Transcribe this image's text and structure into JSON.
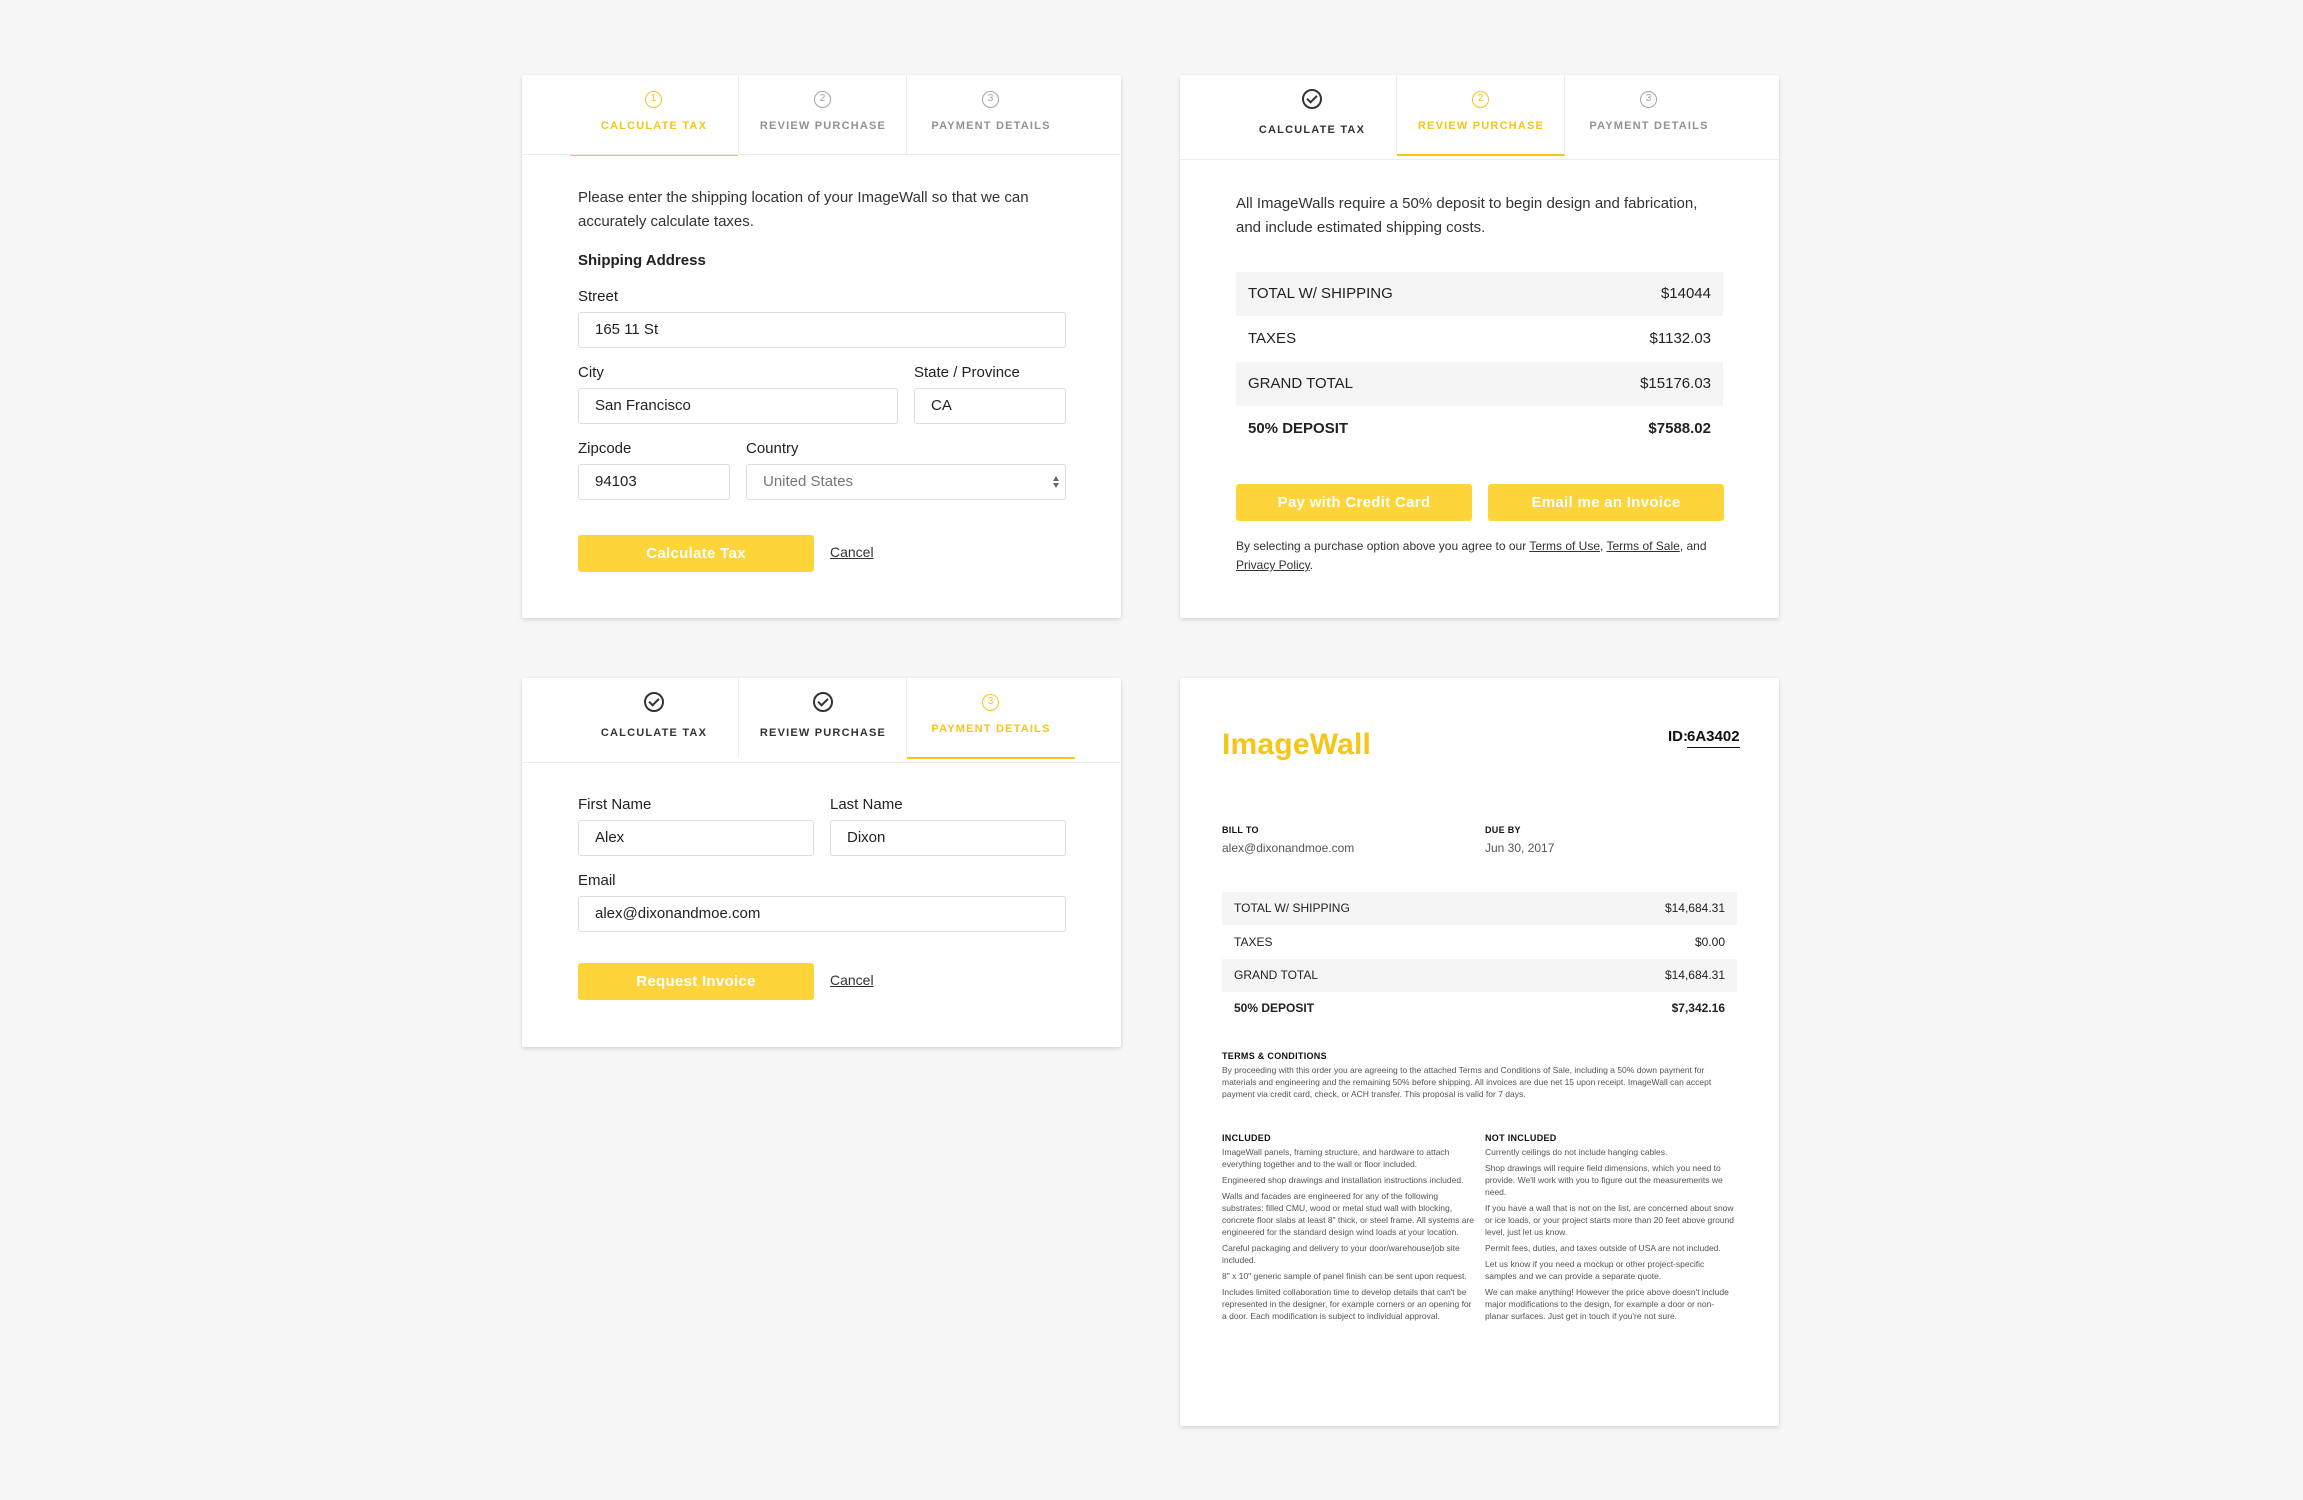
{
  "steps": {
    "calculate_tax": "CALCULATE TAX",
    "review_purchase": "REVIEW PURCHASE",
    "payment_details": "PAYMENT DETAILS",
    "num1": "1",
    "num2": "2",
    "num3": "3"
  },
  "tax_form": {
    "intro": "Please enter the shipping location of your ImageWall so that we can accurately calculate taxes.",
    "section_title": "Shipping Address",
    "street_label": "Street",
    "street_value": "165 11 St",
    "city_label": "City",
    "city_value": "San Francisco",
    "state_label": "State / Province",
    "state_value": "CA",
    "zip_label": "Zipcode",
    "zip_value": "94103",
    "country_label": "Country",
    "country_value": "United States",
    "submit_label": "Calculate Tax",
    "cancel_label": "Cancel"
  },
  "review": {
    "intro": "All ImageWalls require a 50% deposit to begin design and fabrication, and include estimated shipping costs.",
    "rows": [
      {
        "label": "TOTAL W/ SHIPPING",
        "value": "$14044"
      },
      {
        "label": "TAXES",
        "value": "$1132.03"
      },
      {
        "label": "GRAND TOTAL",
        "value": "$15176.03"
      },
      {
        "label": "50% DEPOSIT",
        "value": "$7588.02"
      }
    ],
    "pay_card_label": "Pay with Credit Card",
    "email_invoice_label": "Email me an Invoice",
    "legal_prefix": "By selecting a purchase option above you agree to our ",
    "terms_of_use": "Terms of Use",
    "comma": ", ",
    "terms_of_sale": "Terms of Sale",
    "and": ", and",
    "privacy_policy": "Privacy Policy",
    "period": "."
  },
  "payment_form": {
    "first_name_label": "First Name",
    "first_name_value": "Alex",
    "last_name_label": "Last Name",
    "last_name_value": "Dixon",
    "email_label": "Email",
    "email_value": "alex@dixonandmoe.com",
    "submit_label": "Request Invoice",
    "cancel_label": "Cancel"
  },
  "invoice": {
    "logo": "ImageWall",
    "id_label": "ID:",
    "id_value": "6A3402",
    "bill_to_label": "BILL TO",
    "bill_to_value": "alex@dixonandmoe.com",
    "due_by_label": "DUE BY",
    "due_by_value": "Jun 30, 2017",
    "rows": [
      {
        "label": "TOTAL W/ SHIPPING",
        "value": "$14,684.31"
      },
      {
        "label": "TAXES",
        "value": "$0.00"
      },
      {
        "label": "GRAND TOTAL",
        "value": "$14,684.31"
      },
      {
        "label": "50% DEPOSIT",
        "value": "$7,342.16"
      }
    ],
    "terms_title": "TERMS & CONDITIONS",
    "terms_text": "By proceeding with this order you are agreeing to the attached Terms and Conditions of Sale, including a 50% down payment for materials and engineering and the remaining 50% before shipping. All invoices are due net 15 upon receipt. ImageWall can accept payment via credit card, check, or ACH transfer. This proposal is valid for 7 days.",
    "included_title": "INCLUDED",
    "included": [
      "ImageWall panels, framing structure, and hardware to attach everything together and to the wall or floor included.",
      "Engineered shop drawings and installation instructions included.",
      "Walls and facades are engineered for any of the following substrates: filled CMU, wood or metal stud wall with blocking, concrete floor slabs at least 8\" thick, or steel frame. All systems are engineered for the standard design wind loads at your location.",
      "Careful packaging and delivery to your door/warehouse/job site included.",
      "8\" x 10\" generic sample of panel finish can be sent upon request.",
      "Includes limited collaboration time to develop details that can't be represented in the designer, for example corners or an opening for a door. Each modification is subject to individual approval."
    ],
    "not_included_title": "NOT INCLUDED",
    "not_included": [
      "Currently ceilings do not include hanging cables.",
      "Shop drawings will require field dimensions, which you need to provide. We'll work with you to figure out the measurements we need.",
      "If you have a wall that is not on the list, are concerned about snow or ice loads, or your project starts more than 20 feet above ground level, just let us know.",
      "Permit fees, duties, and taxes outside of USA are not included.",
      "Let us know if you need a mockup or other project-specific samples and we can provide a separate quote.",
      "We can make anything! However the price above doesn't include major modifications to the design, for example a door or non-planar surfaces. Just get in touch if you're not sure."
    ]
  },
  "colors": {
    "accent": "#f5c518",
    "button": "#fdd43a",
    "background": "#f6f7f6"
  }
}
